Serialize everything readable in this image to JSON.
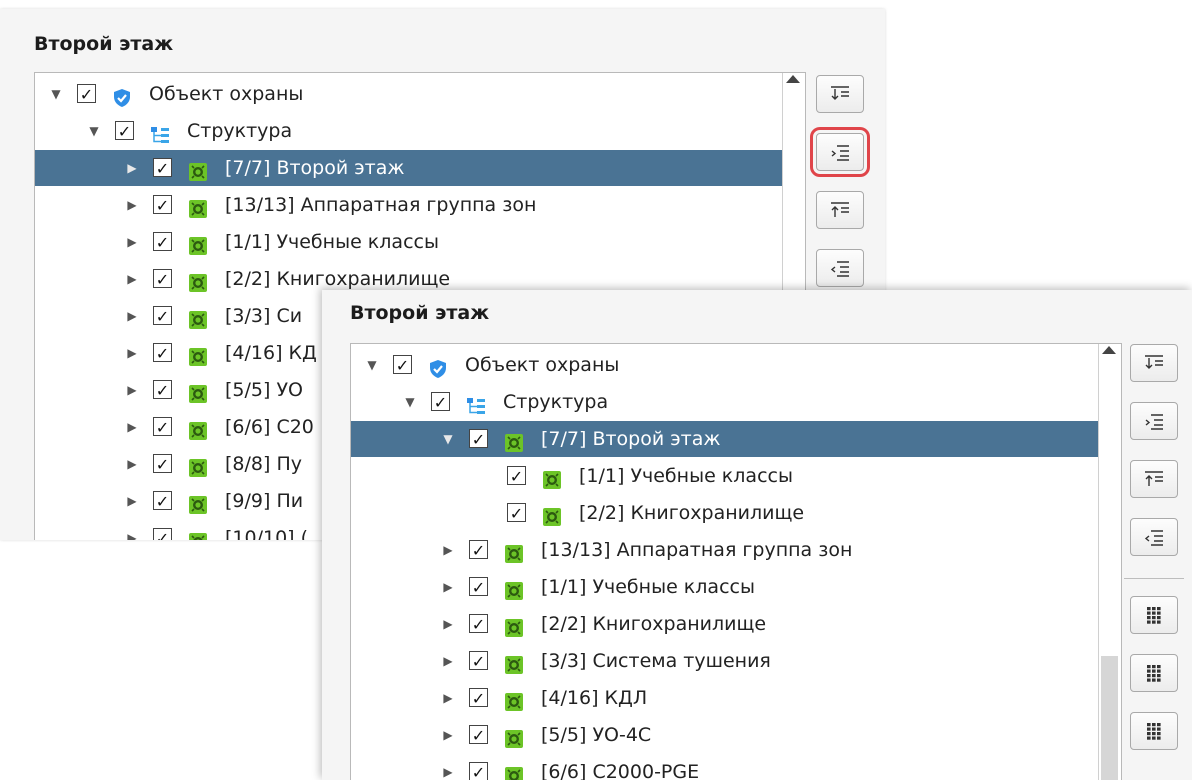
{
  "colors": {
    "selection": "#4a7394",
    "highlight": "#e0454a",
    "node_green": "#6cc427",
    "shield": "#2f8ee6"
  },
  "back_panel": {
    "title": "Второй этаж",
    "rows": [
      {
        "label": "Объект охраны",
        "depth": 0,
        "expander": "expanded",
        "icon": "shield-icon",
        "checked": "✓"
      },
      {
        "label": "Структура",
        "depth": 1,
        "expander": "expanded",
        "icon": "structure-icon",
        "checked": "✓"
      },
      {
        "label": "[7/7] Второй этаж",
        "depth": 2,
        "expander": "collapsed",
        "icon": "device-icon",
        "checked": "✓",
        "selected": true
      },
      {
        "label": "[13/13] Аппаратная группа зон",
        "depth": 2,
        "expander": "collapsed",
        "icon": "device-icon",
        "checked": "✓"
      },
      {
        "label": "[1/1] Учебные классы",
        "depth": 2,
        "expander": "collapsed",
        "icon": "device-icon",
        "checked": "✓"
      },
      {
        "label": "[2/2] Книгохранилище",
        "depth": 2,
        "expander": "collapsed",
        "icon": "device-icon",
        "checked": "✓"
      },
      {
        "label": "[3/3] Си",
        "depth": 2,
        "expander": "collapsed",
        "icon": "device-icon",
        "checked": "✓"
      },
      {
        "label": "[4/16] КД",
        "depth": 2,
        "expander": "collapsed",
        "icon": "device-icon",
        "checked": "✓"
      },
      {
        "label": "[5/5] УО",
        "depth": 2,
        "expander": "collapsed",
        "icon": "device-icon",
        "checked": "✓"
      },
      {
        "label": "[6/6] С20",
        "depth": 2,
        "expander": "collapsed",
        "icon": "device-icon",
        "checked": "✓"
      },
      {
        "label": "[8/8] Пу",
        "depth": 2,
        "expander": "collapsed",
        "icon": "device-icon",
        "checked": "✓"
      },
      {
        "label": "[9/9] Пи",
        "depth": 2,
        "expander": "collapsed",
        "icon": "device-icon",
        "checked": "✓"
      },
      {
        "label": "[10/10] (",
        "depth": 2,
        "expander": "collapsed",
        "icon": "device-icon",
        "checked": "✓"
      }
    ],
    "toolbar": [
      "expand-all-icon",
      "expand-selected-icon",
      "collapse-all-icon",
      "collapse-selected-icon"
    ]
  },
  "front_panel": {
    "title": "Второй этаж",
    "rows": [
      {
        "label": "Объект охраны",
        "depth": 0,
        "expander": "expanded",
        "icon": "shield-icon",
        "checked": "✓"
      },
      {
        "label": "Структура",
        "depth": 1,
        "expander": "expanded",
        "icon": "structure-icon",
        "checked": "✓"
      },
      {
        "label": "[7/7] Второй этаж",
        "depth": 2,
        "expander": "expanded",
        "icon": "device-icon",
        "checked": "✓",
        "selected": true
      },
      {
        "label": "[1/1] Учебные классы",
        "depth": 3,
        "expander": "none",
        "icon": "device-icon",
        "checked": "✓"
      },
      {
        "label": "[2/2] Книгохранилище",
        "depth": 3,
        "expander": "none",
        "icon": "device-icon",
        "checked": "✓"
      },
      {
        "label": "[13/13] Аппаратная группа зон",
        "depth": 2,
        "expander": "collapsed",
        "icon": "device-icon",
        "checked": "✓"
      },
      {
        "label": "[1/1] Учебные классы",
        "depth": 2,
        "expander": "collapsed",
        "icon": "device-icon",
        "checked": "✓"
      },
      {
        "label": "[2/2] Книгохранилище",
        "depth": 2,
        "expander": "collapsed",
        "icon": "device-icon",
        "checked": "✓"
      },
      {
        "label": "[3/3] Система тушения",
        "depth": 2,
        "expander": "collapsed",
        "icon": "device-icon",
        "checked": "✓"
      },
      {
        "label": "[4/16] КДЛ",
        "depth": 2,
        "expander": "collapsed",
        "icon": "device-icon",
        "checked": "✓"
      },
      {
        "label": "[5/5] УО-4С",
        "depth": 2,
        "expander": "collapsed",
        "icon": "device-icon",
        "checked": "✓"
      },
      {
        "label": "[6/6] С2000-PGE",
        "depth": 2,
        "expander": "collapsed",
        "icon": "device-icon",
        "checked": "✓"
      }
    ],
    "toolbar": [
      "expand-all-icon",
      "expand-selected-icon",
      "collapse-all-icon",
      "collapse-selected-icon",
      "grid-icon",
      "grid-icon",
      "grid-icon"
    ]
  }
}
